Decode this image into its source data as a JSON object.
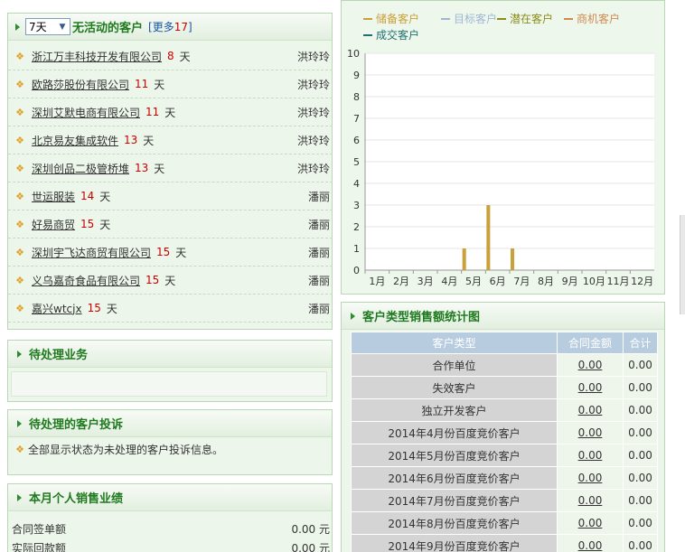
{
  "inactive": {
    "select_value": "7天",
    "title": "无活动的客户",
    "more_prefix": "[更多",
    "more_count": "17",
    "more_suffix": "]",
    "day_unit": "天",
    "rows": [
      {
        "name": "浙江万丰科技开发有限公司",
        "days": "8",
        "owner": "洪玲玲"
      },
      {
        "name": "欧路莎股份有限公司",
        "days": "11",
        "owner": "洪玲玲"
      },
      {
        "name": "深圳艾默电商有限公司",
        "days": "11",
        "owner": "洪玲玲"
      },
      {
        "name": "北京易友集成软件",
        "days": "13",
        "owner": "洪玲玲"
      },
      {
        "name": "深圳创品二极管桥堆",
        "days": "13",
        "owner": "洪玲玲"
      },
      {
        "name": "世运服装",
        "days": "14",
        "owner": "潘丽"
      },
      {
        "name": "好易商贸",
        "days": "15",
        "owner": "潘丽"
      },
      {
        "name": "深圳宇飞达商贸有限公司",
        "days": "15",
        "owner": "潘丽"
      },
      {
        "name": "义乌嘉奇食品有限公司",
        "days": "15",
        "owner": "潘丽"
      },
      {
        "name": "嘉兴wtcjx",
        "days": "15",
        "owner": "潘丽"
      }
    ]
  },
  "pending_business": {
    "title": "待处理业务"
  },
  "complaints": {
    "title": "待处理的客户投诉",
    "note": "全部显示状态为未处理的客户投诉信息。"
  },
  "sales": {
    "title": "本月个人销售业绩",
    "rows": [
      {
        "label": "合同签单额",
        "value": "0.00 元"
      },
      {
        "label": "实际回款额",
        "value": "0.00 元"
      }
    ]
  },
  "chart_data": {
    "type": "bar",
    "legend": [
      "储备客户",
      "目标客户",
      "潜在客户",
      "商机客户",
      "成交客户"
    ],
    "legend_colors": [
      "#c9a03a",
      "#9fb7d3",
      "#8c8c1c",
      "#d08a50",
      "#1f7070"
    ],
    "categories": [
      "1月",
      "2月",
      "3月",
      "4月",
      "5月",
      "6月",
      "7月",
      "8月",
      "9月",
      "10月",
      "11月",
      "12月"
    ],
    "series": [
      {
        "name": "储备客户",
        "values": [
          0,
          0,
          0,
          0,
          1,
          3,
          1,
          0,
          0,
          0,
          0,
          0
        ]
      }
    ],
    "ylim": [
      0,
      10
    ],
    "yticks": [
      "0",
      "1",
      "2",
      "3",
      "4",
      "5",
      "6",
      "7",
      "8",
      "9",
      "10"
    ],
    "grid": true
  },
  "type_stats": {
    "title": "客户类型销售额统计图",
    "headers": [
      "客户类型",
      "合同金额",
      "合计"
    ],
    "rows": [
      {
        "type": "合作单位",
        "amount": "0.00",
        "total": "0.00"
      },
      {
        "type": "失效客户",
        "amount": "0.00",
        "total": "0.00"
      },
      {
        "type": "独立开发客户",
        "amount": "0.00",
        "total": "0.00"
      },
      {
        "type": "2014年4月份百度竞价客户",
        "amount": "0.00",
        "total": "0.00"
      },
      {
        "type": "2014年5月份百度竞价客户",
        "amount": "0.00",
        "total": "0.00"
      },
      {
        "type": "2014年6月份百度竞价客户",
        "amount": "0.00",
        "total": "0.00"
      },
      {
        "type": "2014年7月份百度竞价客户",
        "amount": "0.00",
        "total": "0.00"
      },
      {
        "type": "2014年8月份百度竞价客户",
        "amount": "0.00",
        "total": "0.00"
      },
      {
        "type": "2014年9月份百度竞价客户",
        "amount": "0.00",
        "total": "0.00"
      }
    ]
  }
}
